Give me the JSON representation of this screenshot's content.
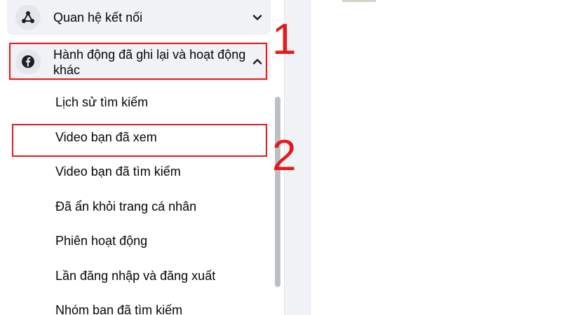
{
  "sections": {
    "connections": {
      "label": "Quan hệ kết nối",
      "icon": "connections-icon",
      "expanded": false
    },
    "activity": {
      "label": "Hành động đã ghi lại và hoạt động khác",
      "icon": "facebook-icon",
      "expanded": true
    }
  },
  "activity_items": [
    {
      "label": "Lịch sử tìm kiếm"
    },
    {
      "label": "Video bạn đã xem"
    },
    {
      "label": "Video bạn đã tìm kiếm"
    },
    {
      "label": "Đã ẩn khỏi trang cá nhân"
    },
    {
      "label": "Phiên hoạt động"
    },
    {
      "label": "Lần đăng nhập và đăng xuất"
    },
    {
      "label": "Nhóm bạn đã tìm kiếm"
    }
  ],
  "annotations": {
    "step1": "1",
    "step2": "2"
  },
  "colors": {
    "annotation_red": "#e21b1b",
    "section_bg": "#f0f2f5",
    "icon_circle": "#e4e6eb",
    "text": "#050505",
    "scrollbar": "#bcc0c4"
  }
}
